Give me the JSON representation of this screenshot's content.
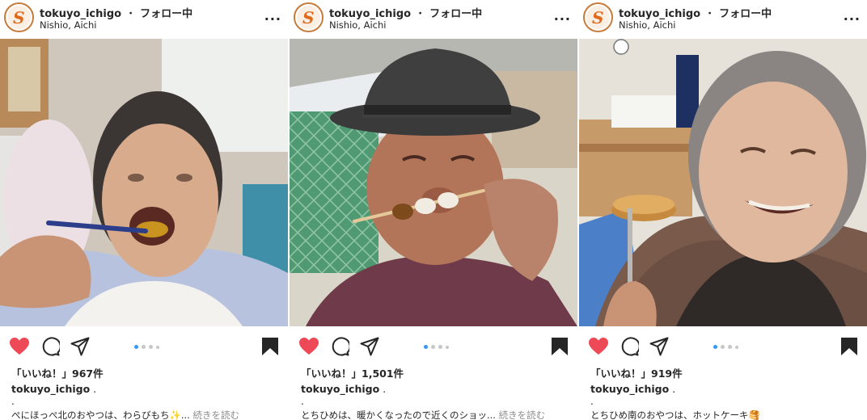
{
  "posts": [
    {
      "username": "tokuyo_ichigo",
      "separator": "・",
      "follow_status": "フォロー中",
      "location": "Nishio, Aichi",
      "more_label": "...",
      "likes": "「いいね！」967件",
      "caption_username": "tokuyo_ichigo",
      "caption_first_line": ".",
      "caption_dot": ".",
      "caption_text": "ぺにほっぺ北のおやつは、わらびもち✨...",
      "caption_more": "続きを読む",
      "carousel_active_index": 0,
      "liked": true
    },
    {
      "username": "tokuyo_ichigo",
      "separator": "・",
      "follow_status": "フォロー中",
      "location": "Nishio, Aichi",
      "more_label": "...",
      "likes": "「いいね！」1,501件",
      "caption_username": "tokuyo_ichigo",
      "caption_first_line": ".",
      "caption_dot": ".",
      "caption_text": "とちひめは、暖かくなったので近くのショッ...",
      "caption_more": "続きを読む",
      "carousel_active_index": 0,
      "liked": true
    },
    {
      "username": "tokuyo_ichigo",
      "separator": "・",
      "follow_status": "フォロー中",
      "location": "Nishio, Aichi",
      "more_label": "...",
      "likes": "「いいね！」919件",
      "caption_username": "tokuyo_ichigo",
      "caption_first_line": ".",
      "caption_dot": ".",
      "caption_text": "とちひめ南のおやつは、ホットケーキ🥞",
      "caption_more": "",
      "carousel_active_index": 0,
      "liked": true
    }
  ],
  "icons": {
    "heart": "heart-icon",
    "comment": "comment-icon",
    "share": "share-icon",
    "bookmark": "bookmark-icon",
    "more": "more-options-icon"
  },
  "colors": {
    "like_red": "#ed4956",
    "carousel_active": "#3897f0",
    "carousel_inactive": "#c7c7c7",
    "brand_orange": "#e06a1c",
    "text": "#262626",
    "muted": "#8e8e8e"
  }
}
